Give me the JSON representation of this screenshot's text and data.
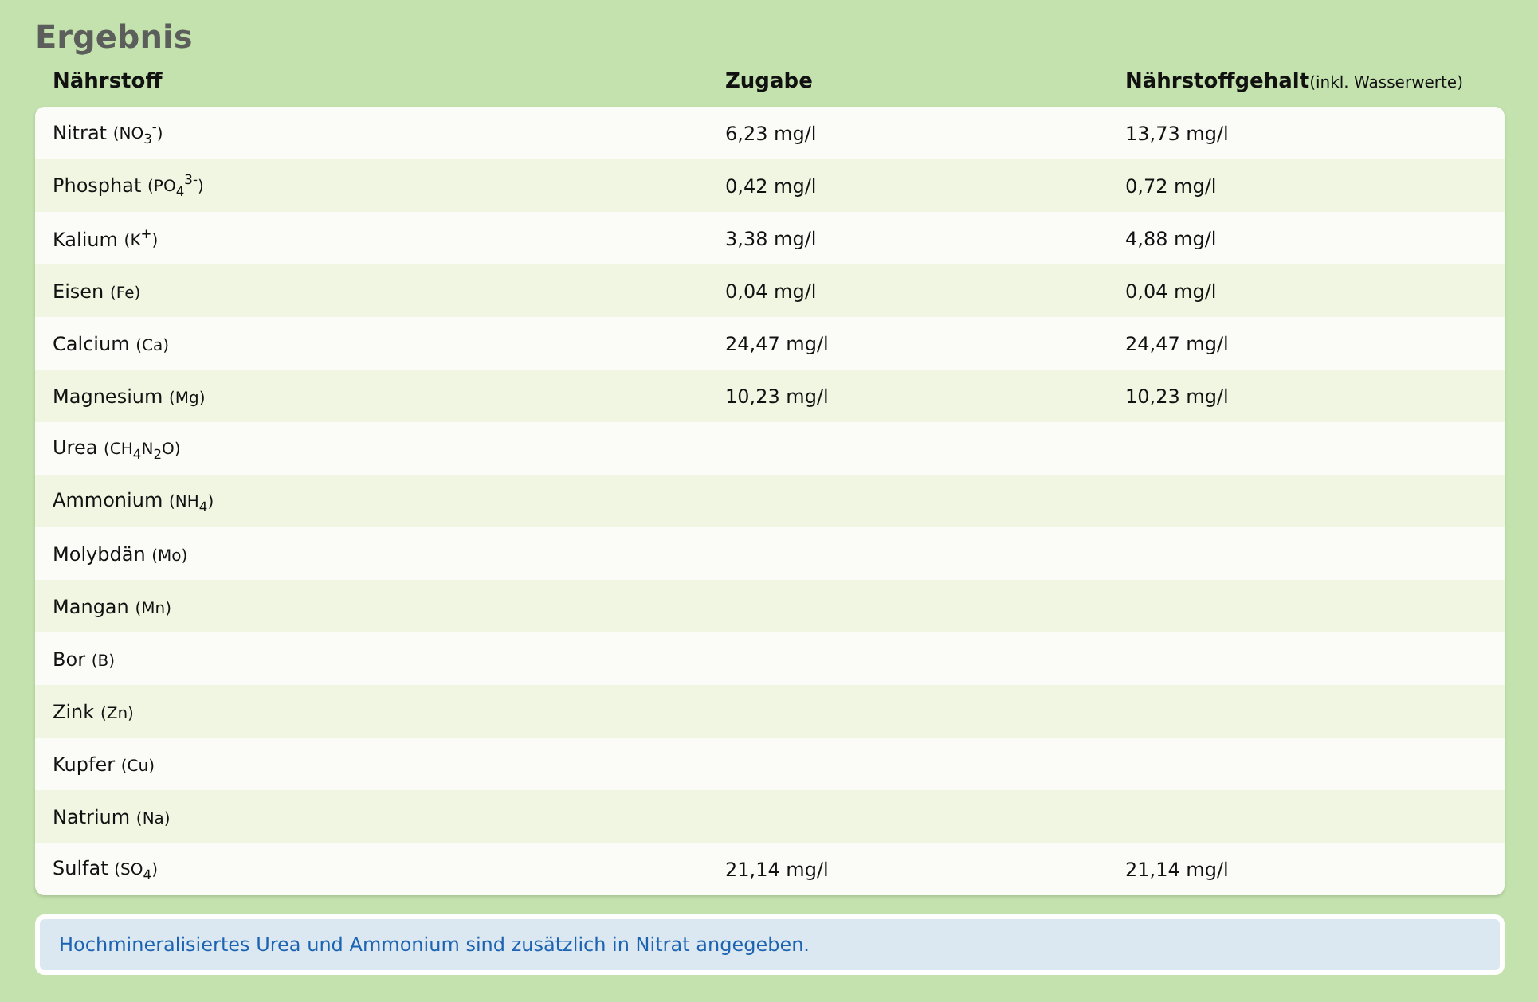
{
  "title": "Ergebnis",
  "columns": [
    {
      "label": "Nährstoff"
    },
    {
      "label": "Zugabe"
    },
    {
      "label": "Nährstoffgehalt",
      "note": "(inkl. Wasserwerte)"
    }
  ],
  "rows": [
    {
      "name": "Nitrat",
      "formula": "(NO$_{3}$$^{-}$)",
      "added": "6,23 mg/l",
      "content": "13,73 mg/l"
    },
    {
      "name": "Phosphat",
      "formula": "(PO$_{4}$$^{3-}$)",
      "added": "0,42 mg/l",
      "content": "0,72 mg/l"
    },
    {
      "name": "Kalium",
      "formula": "(K$^{+}$)",
      "added": "3,38 mg/l",
      "content": "4,88 mg/l"
    },
    {
      "name": "Eisen",
      "formula": "(Fe)",
      "added": "0,04 mg/l",
      "content": "0,04 mg/l"
    },
    {
      "name": "Calcium",
      "formula": "(Ca)",
      "added": "24,47 mg/l",
      "content": "24,47 mg/l"
    },
    {
      "name": "Magnesium",
      "formula": "(Mg)",
      "added": "10,23 mg/l",
      "content": "10,23 mg/l"
    },
    {
      "name": "Urea",
      "formula": "(CH$_{4}$N$_{2}$O)"
    },
    {
      "name": "Ammonium",
      "formula": "(NH$_{4}$)"
    },
    {
      "name": "Molybdän",
      "formula": "(Mo)"
    },
    {
      "name": "Mangan",
      "formula": "(Mn)"
    },
    {
      "name": "Bor",
      "formula": "(B)"
    },
    {
      "name": "Zink",
      "formula": "(Zn)"
    },
    {
      "name": "Kupfer",
      "formula": "(Cu)"
    },
    {
      "name": "Natrium",
      "formula": "(Na)"
    },
    {
      "name": "Sulfat",
      "formula": "(SO$_{4}$)",
      "added": "21,14 mg/l",
      "content": "21,14 mg/l"
    }
  ],
  "info": "Hochmineralisiertes Urea und Ammonium sind zusätzlich in Nitrat angegeben."
}
